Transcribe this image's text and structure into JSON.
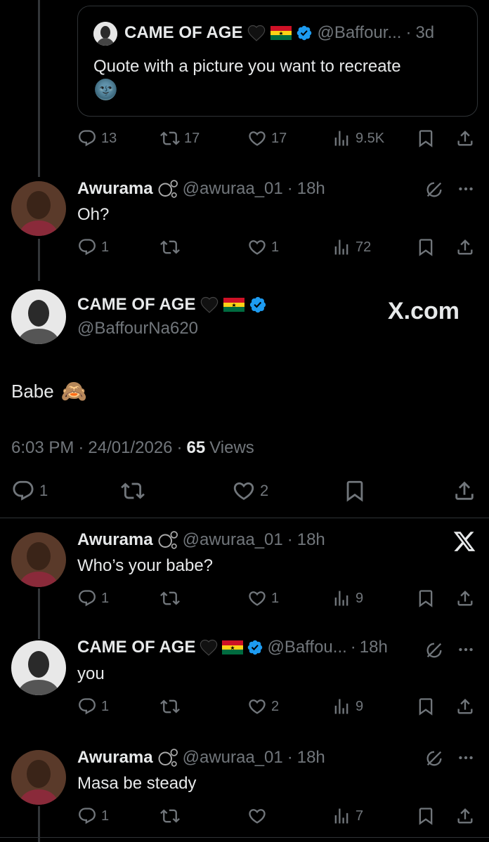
{
  "quote": {
    "name": "CAME OF AGE",
    "handle": "@Baffour...",
    "time": "3d",
    "text": "Quote with a picture you want to recreate",
    "emoji": "🌚"
  },
  "quote_actions": {
    "replies": "13",
    "reposts": "17",
    "likes": "17",
    "views": "9.5K"
  },
  "reply1": {
    "name": "Awurama",
    "handle": "@awuraa_01",
    "time": "18h",
    "text": "Oh?",
    "actions": {
      "replies": "1",
      "reposts": "",
      "likes": "1",
      "views": "72"
    }
  },
  "main": {
    "name": "CAME OF AGE",
    "handle": "@BaffourNa620",
    "watermark": "X.com",
    "text": "Babe",
    "emoji": "🙈",
    "time": "6:03 PM",
    "date": "24/01/2026",
    "views_count": "65",
    "views_label": "Views",
    "actions": {
      "replies": "1",
      "reposts": "",
      "likes": "2"
    }
  },
  "reply2": {
    "name": "Awurama",
    "handle": "@awuraa_01",
    "time": "18h",
    "text": "Who’s your babe?",
    "actions": {
      "replies": "1",
      "reposts": "",
      "likes": "1",
      "views": "9"
    }
  },
  "reply3": {
    "name": "CAME OF AGE",
    "handle": "@Baffou...",
    "time": "18h",
    "text": "you",
    "actions": {
      "replies": "1",
      "reposts": "",
      "likes": "2",
      "views": "9"
    }
  },
  "reply4": {
    "name": "Awurama",
    "handle": "@awuraa_01",
    "time": "18h",
    "text": "Masa be steady",
    "actions": {
      "replies": "1",
      "reposts": "",
      "likes": "",
      "views": "7"
    }
  },
  "separator": "·",
  "colors": {
    "verified": "#1d9bf0",
    "muted": "#71767b",
    "text": "#e7e9ea",
    "bg": "#000000"
  }
}
